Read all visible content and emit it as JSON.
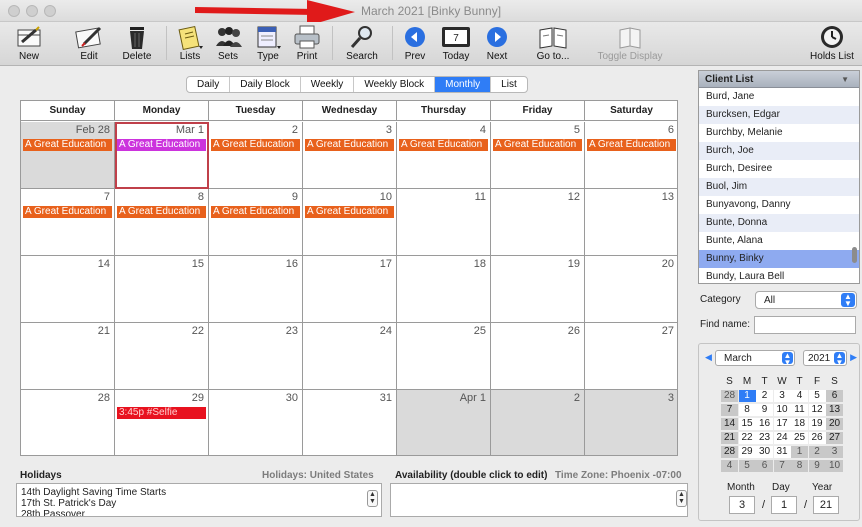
{
  "window": {
    "title": "March 2021  [Binky Bunny]"
  },
  "toolbar": {
    "new": "New",
    "edit": "Edit",
    "delete": "Delete",
    "lists": "Lists",
    "sets": "Sets",
    "type": "Type",
    "print": "Print",
    "search": "Search",
    "prev": "Prev",
    "today": "Today",
    "today_icon_number": "7",
    "next": "Next",
    "goto": "Go to...",
    "toggle_display": "Toggle Display",
    "holds_list": "Holds List"
  },
  "view_tabs": [
    "Daily",
    "Daily Block",
    "Weekly",
    "Weekly Block",
    "Monthly",
    "List"
  ],
  "active_tab": "Monthly",
  "calendar": {
    "day_headers": [
      "Sunday",
      "Monday",
      "Tuesday",
      "Wednesday",
      "Thursday",
      "Friday",
      "Saturday"
    ],
    "weeks": [
      [
        {
          "label": "Feb 28",
          "other_month": true,
          "events": [
            {
              "text": "A Great Education",
              "color": "#e8611c"
            }
          ]
        },
        {
          "label": "Mar 1",
          "selected": true,
          "events": [
            {
              "text": "A Great Education",
              "color": "#cc33dd"
            }
          ]
        },
        {
          "label": "2",
          "events": [
            {
              "text": "A Great Education",
              "color": "#e8611c"
            }
          ]
        },
        {
          "label": "3",
          "events": [
            {
              "text": "A Great Education",
              "color": "#e8611c"
            }
          ]
        },
        {
          "label": "4",
          "events": [
            {
              "text": "A Great Education",
              "color": "#e8611c"
            }
          ]
        },
        {
          "label": "5",
          "events": [
            {
              "text": "A Great Education",
              "color": "#e8611c"
            }
          ]
        },
        {
          "label": "6",
          "events": [
            {
              "text": "A Great Education",
              "color": "#e8611c"
            }
          ]
        }
      ],
      [
        {
          "label": "7",
          "events": [
            {
              "text": "A Great Education",
              "color": "#e8611c"
            }
          ]
        },
        {
          "label": "8",
          "events": [
            {
              "text": "A Great Education",
              "color": "#e8611c"
            }
          ]
        },
        {
          "label": "9",
          "events": [
            {
              "text": "A Great Education",
              "color": "#e8611c"
            }
          ]
        },
        {
          "label": "10",
          "events": [
            {
              "text": "A Great Education",
              "color": "#e8611c"
            }
          ]
        },
        {
          "label": "11",
          "events": []
        },
        {
          "label": "12",
          "events": []
        },
        {
          "label": "13",
          "events": []
        }
      ],
      [
        {
          "label": "14",
          "events": []
        },
        {
          "label": "15",
          "events": []
        },
        {
          "label": "16",
          "events": []
        },
        {
          "label": "17",
          "events": []
        },
        {
          "label": "18",
          "events": []
        },
        {
          "label": "19",
          "events": []
        },
        {
          "label": "20",
          "events": []
        }
      ],
      [
        {
          "label": "21",
          "events": []
        },
        {
          "label": "22",
          "events": []
        },
        {
          "label": "23",
          "events": []
        },
        {
          "label": "24",
          "events": []
        },
        {
          "label": "25",
          "events": []
        },
        {
          "label": "26",
          "events": []
        },
        {
          "label": "27",
          "events": []
        }
      ],
      [
        {
          "label": "28",
          "events": []
        },
        {
          "label": "29",
          "events": [
            {
              "text": "3:45p #Selfie",
              "color": "#e8121f"
            }
          ]
        },
        {
          "label": "30",
          "events": []
        },
        {
          "label": "31",
          "events": []
        },
        {
          "label": "Apr 1",
          "other_month": true,
          "events": []
        },
        {
          "label": "2",
          "other_month": true,
          "events": []
        },
        {
          "label": "3",
          "other_month": true,
          "events": []
        }
      ]
    ]
  },
  "holidays": {
    "label": "Holidays",
    "country": "Holidays: United States",
    "items": [
      "14th Daylight Saving Time Starts",
      "17th St. Patrick's Day",
      "28th Passover"
    ]
  },
  "availability": {
    "label": "Availability (double click to edit)",
    "timezone": "Time Zone: Phoenix -07:00"
  },
  "client_list": {
    "header": "Client List",
    "items": [
      "Burd, Jane",
      "Burcksen, Edgar",
      "Burchby, Melanie",
      "Burch, Joe",
      "Burch, Desiree",
      "Buol, Jim",
      "Bunyavong, Danny",
      "Bunte, Donna",
      "Bunte, Alana",
      "Bunny, Binky",
      "Bundy, Laura Bell"
    ],
    "selected": "Bunny, Binky"
  },
  "filters": {
    "category_label": "Category",
    "category_value": "All",
    "find_label": "Find name:",
    "find_value": ""
  },
  "mini_calendar": {
    "month": "March",
    "year": "2021",
    "day_headers": [
      "S",
      "M",
      "T",
      "W",
      "T",
      "F",
      "S"
    ],
    "weeks": [
      [
        "28",
        "1",
        "2",
        "3",
        "4",
        "5",
        "6"
      ],
      [
        "7",
        "8",
        "9",
        "10",
        "11",
        "12",
        "13"
      ],
      [
        "14",
        "15",
        "16",
        "17",
        "18",
        "19",
        "20"
      ],
      [
        "21",
        "22",
        "23",
        "24",
        "25",
        "26",
        "27"
      ],
      [
        "28",
        "29",
        "30",
        "31",
        "1",
        "2",
        "3"
      ],
      [
        "4",
        "5",
        "6",
        "7",
        "8",
        "9",
        "10"
      ]
    ],
    "selected_day": "1",
    "month_label": "Month",
    "day_label": "Day",
    "year_label": "Year",
    "month_value": "3",
    "day_value": "1",
    "year_value": "21"
  },
  "colors": {
    "accent": "#2f7df6",
    "event_orange": "#e8611c",
    "event_purple": "#cc33dd",
    "event_red": "#e8121f",
    "annotation_arrow": "#e01a1a"
  }
}
